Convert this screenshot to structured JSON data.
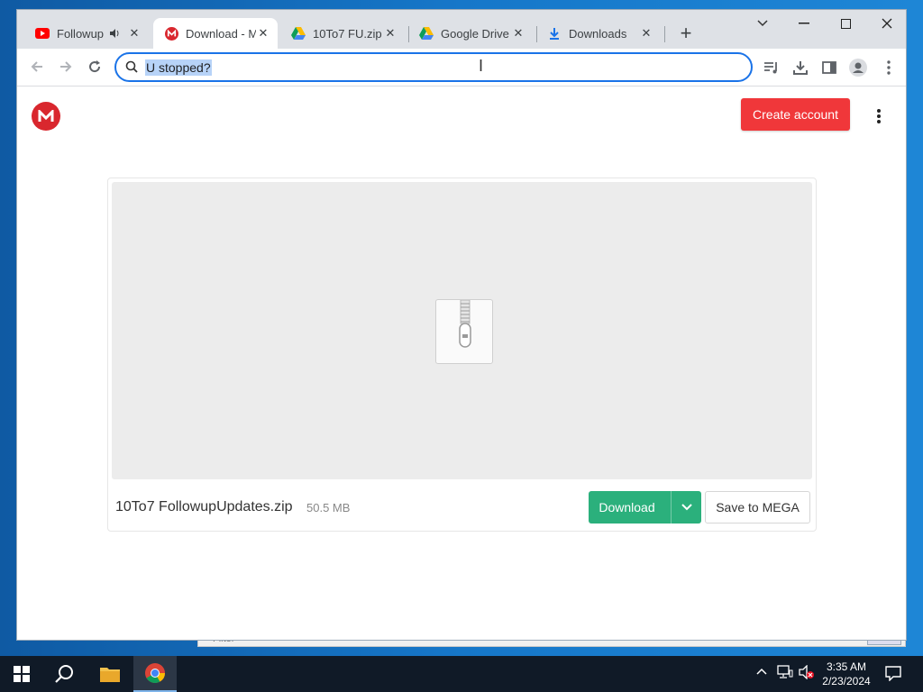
{
  "browser": {
    "tabs": [
      {
        "title": "Followup",
        "favicon": "youtube-icon",
        "audio": true,
        "active": false
      },
      {
        "title": "Download - M",
        "favicon": "mega-icon",
        "active": true
      },
      {
        "title": "10To7 FU.zip -",
        "favicon": "google-drive-icon",
        "active": false
      },
      {
        "title": "Google Drive -",
        "favicon": "google-drive-icon",
        "active": false
      },
      {
        "title": "Downloads",
        "favicon": "download-icon",
        "active": false
      }
    ],
    "omnibox": {
      "value": "U stopped?"
    }
  },
  "page": {
    "create_account": "Create account",
    "file": {
      "name": "10To7 FollowupUpdates.zip",
      "size": "50.5 MB"
    },
    "download_label": "Download",
    "save_label": "Save to MEGA"
  },
  "background_window": {
    "label": "Filter"
  },
  "taskbar": {
    "time": "3:35 AM",
    "date": "2/23/2024"
  },
  "colors": {
    "accent": "#1a73e8",
    "mega_red": "#d9272e",
    "create_button": "#f0373a",
    "download_green": "#2bb07c",
    "taskbar": "#101a27"
  }
}
